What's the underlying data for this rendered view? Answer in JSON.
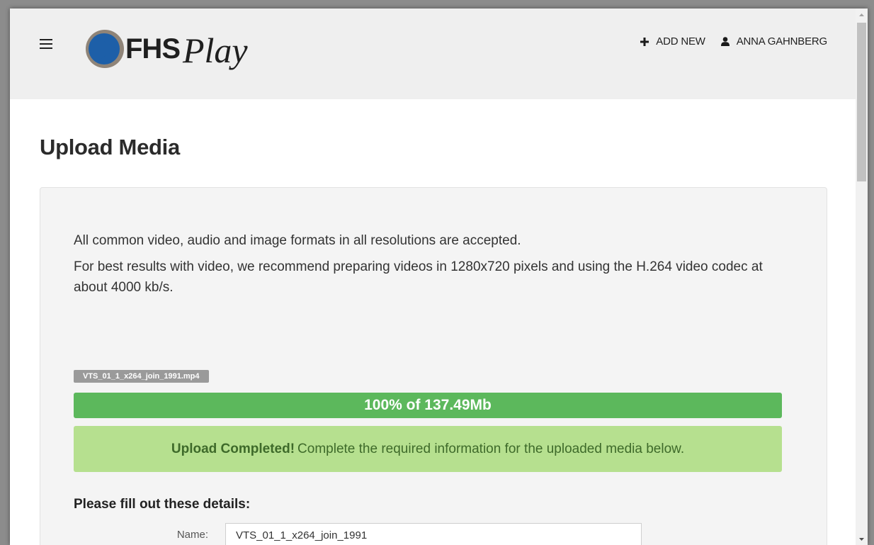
{
  "header": {
    "logo_text_bold": "FHS",
    "logo_text_script": "Play",
    "actions": [
      {
        "label": "ADD NEW",
        "icon": "plus-icon"
      },
      {
        "label": "ANNA GAHNBERG",
        "icon": "user-icon"
      }
    ]
  },
  "page": {
    "title": "Upload Media"
  },
  "upload_panel": {
    "intro_lines": [
      "All common video, audio and image formats in all resolutions are accepted.",
      "For best results with video, we recommend preparing videos in 1280x720 pixels and using the H.264 video codec at about 4000 kb/s."
    ],
    "file_name": "VTS_01_1_x264_join_1991.mp4",
    "progress": {
      "percent": 100,
      "label": "100% of 137.49Mb"
    },
    "alert": {
      "strong": "Upload Completed!",
      "message": "Complete the required information for the uploaded media below."
    },
    "details_heading": "Please fill out these details:",
    "form": {
      "name_label": "Name:",
      "name_value": "VTS_01_1_x264_join_1991"
    }
  },
  "colors": {
    "header_bg": "#efefef",
    "logo_blue": "#1d5fa8",
    "logo_ring": "#8f8478",
    "progress_green": "#5cb85c",
    "alert_green": "#b6e08f",
    "alert_text": "#3e6a2a",
    "file_tag_gray": "#9a9a9a"
  }
}
